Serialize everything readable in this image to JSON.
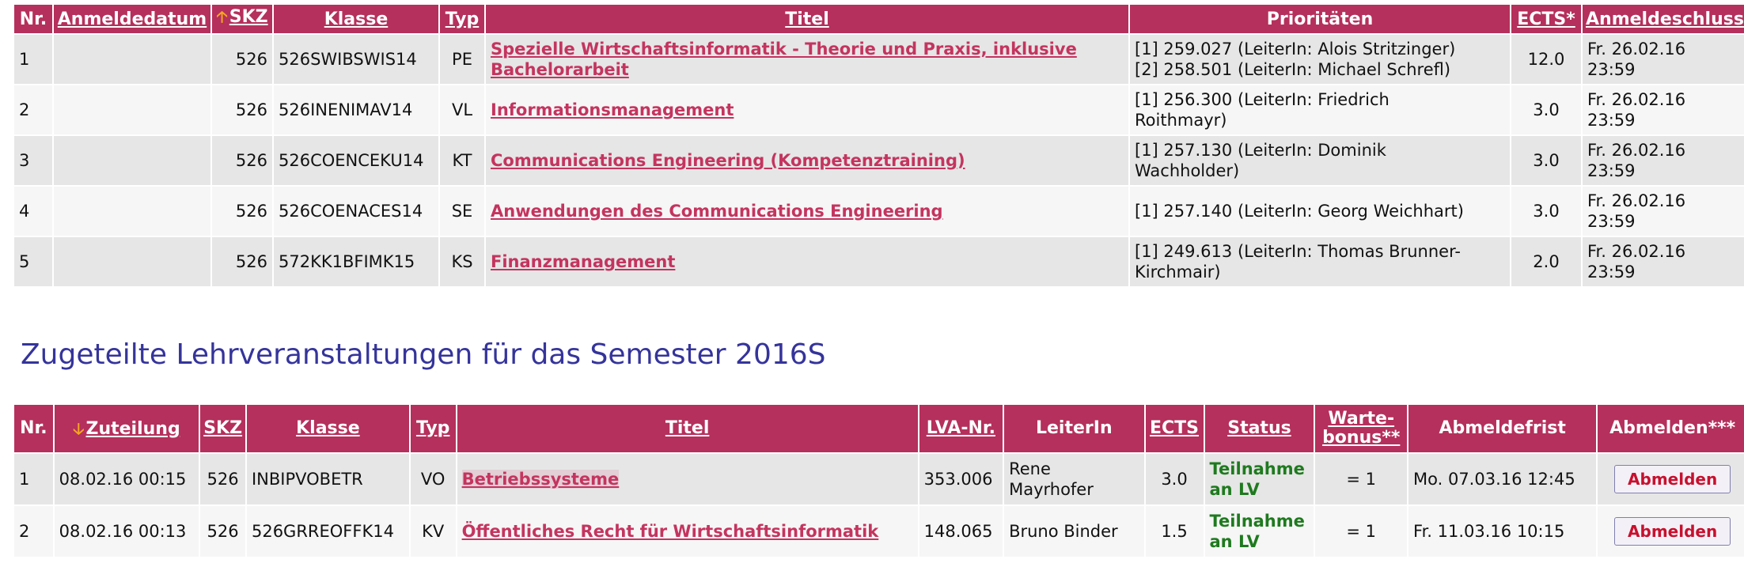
{
  "registrations": {
    "headers": {
      "nr": "Nr.",
      "anmeldedatum": "Anmeldedatum",
      "skz": "SKZ",
      "klasse": "Klasse",
      "typ": "Typ",
      "titel": "Titel",
      "prioritaeten": "Prioritäten",
      "ects": "ECTS*",
      "anmeldeschluss": "Anmeldeschluss"
    },
    "rows": [
      {
        "nr": "1",
        "datum": "",
        "skz": "526",
        "klasse": "526SWIBSWIS14",
        "typ": "PE",
        "titel": "Spezielle Wirtschaftsinformatik - Theorie und Praxis, inklusive Bachelorarbeit",
        "prio1": "[1] 259.027 (LeiterIn: Alois Stritzinger)",
        "prio2": "[2] 258.501 (LeiterIn: Michael Schrefl)",
        "ects": "12.0",
        "schluss1": "Fr. 26.02.16",
        "schluss2": "23:59"
      },
      {
        "nr": "2",
        "datum": "",
        "skz": "526",
        "klasse": "526INENIMAV14",
        "typ": "VL",
        "titel": "Informationsmanagement",
        "prio1": "[1] 256.300 (LeiterIn: Friedrich",
        "prio2": "Roithmayr)",
        "ects": "3.0",
        "schluss1": "Fr. 26.02.16",
        "schluss2": "23:59"
      },
      {
        "nr": "3",
        "datum": "",
        "skz": "526",
        "klasse": "526COENCEKU14",
        "typ": "KT",
        "titel": "Communications Engineering (Kompetenztraining)",
        "prio1": "[1] 257.130 (LeiterIn: Dominik",
        "prio2": "Wachholder)",
        "ects": "3.0",
        "schluss1": "Fr. 26.02.16",
        "schluss2": "23:59"
      },
      {
        "nr": "4",
        "datum": "",
        "skz": "526",
        "klasse": "526COENACES14",
        "typ": "SE",
        "titel": "Anwendungen des Communications Engineering",
        "prio1": "[1] 257.140 (LeiterIn: Georg Weichhart)",
        "prio2": "",
        "ects": "3.0",
        "schluss1": "Fr. 26.02.16",
        "schluss2": "23:59"
      },
      {
        "nr": "5",
        "datum": "",
        "skz": "526",
        "klasse": "572KK1BFIMK15",
        "typ": "KS",
        "titel": "Finanzmanagement",
        "prio1": "[1] 249.613 (LeiterIn: Thomas Brunner-",
        "prio2": "Kirchmair)",
        "ects": "2.0",
        "schluss1": "Fr. 26.02.16",
        "schluss2": "23:59"
      }
    ]
  },
  "assigned": {
    "heading": "Zugeteilte Lehrveranstaltungen für das Semester 2016S",
    "headers": {
      "nr": "Nr.",
      "zuteilung": "Zuteilung",
      "skz": "SKZ",
      "klasse": "Klasse",
      "typ": "Typ",
      "titel": "Titel",
      "lva": "LVA-Nr.",
      "leiter": "LeiterIn",
      "ects": "ECTS",
      "status": "Status",
      "warte1": "Warte-",
      "warte2": "bonus**",
      "abmeldefrist": "Abmeldefrist",
      "abmelden": "Abmelden***"
    },
    "rows": [
      {
        "nr": "1",
        "zuteilung": "08.02.16 00:15",
        "skz": "526",
        "klasse": "INBIPVOBETR",
        "typ": "VO",
        "titel": "Betriebssysteme",
        "lva": "353.006",
        "leiter1": "Rene",
        "leiter2": "Mayrhofer",
        "ects": "3.0",
        "status1": "Teilnahme",
        "status2": "an LV",
        "bonus": "= 1",
        "frist": "Mo. 07.03.16 12:45",
        "button": "Abmelden"
      },
      {
        "nr": "2",
        "zuteilung": "08.02.16 00:13",
        "skz": "526",
        "klasse": "526GRREOFFK14",
        "typ": "KV",
        "titel": "Öffentliches Recht für Wirtschaftsinformatik",
        "lva": "148.065",
        "leiter1": "Bruno Binder",
        "leiter2": "",
        "ects": "1.5",
        "status1": "Teilnahme",
        "status2": "an LV",
        "bonus": "= 1",
        "frist": "Fr. 11.03.16 10:15",
        "button": "Abmelden"
      }
    ]
  },
  "colors": {
    "header_bg": "#b5305c",
    "link": "#c4345f",
    "status_green": "#1f7a1f",
    "heading_blue": "#35349b",
    "sort_arrow": "#f5a623"
  },
  "icons": {
    "sort_up": "arrow-up-icon",
    "sort_down": "arrow-down-icon"
  }
}
